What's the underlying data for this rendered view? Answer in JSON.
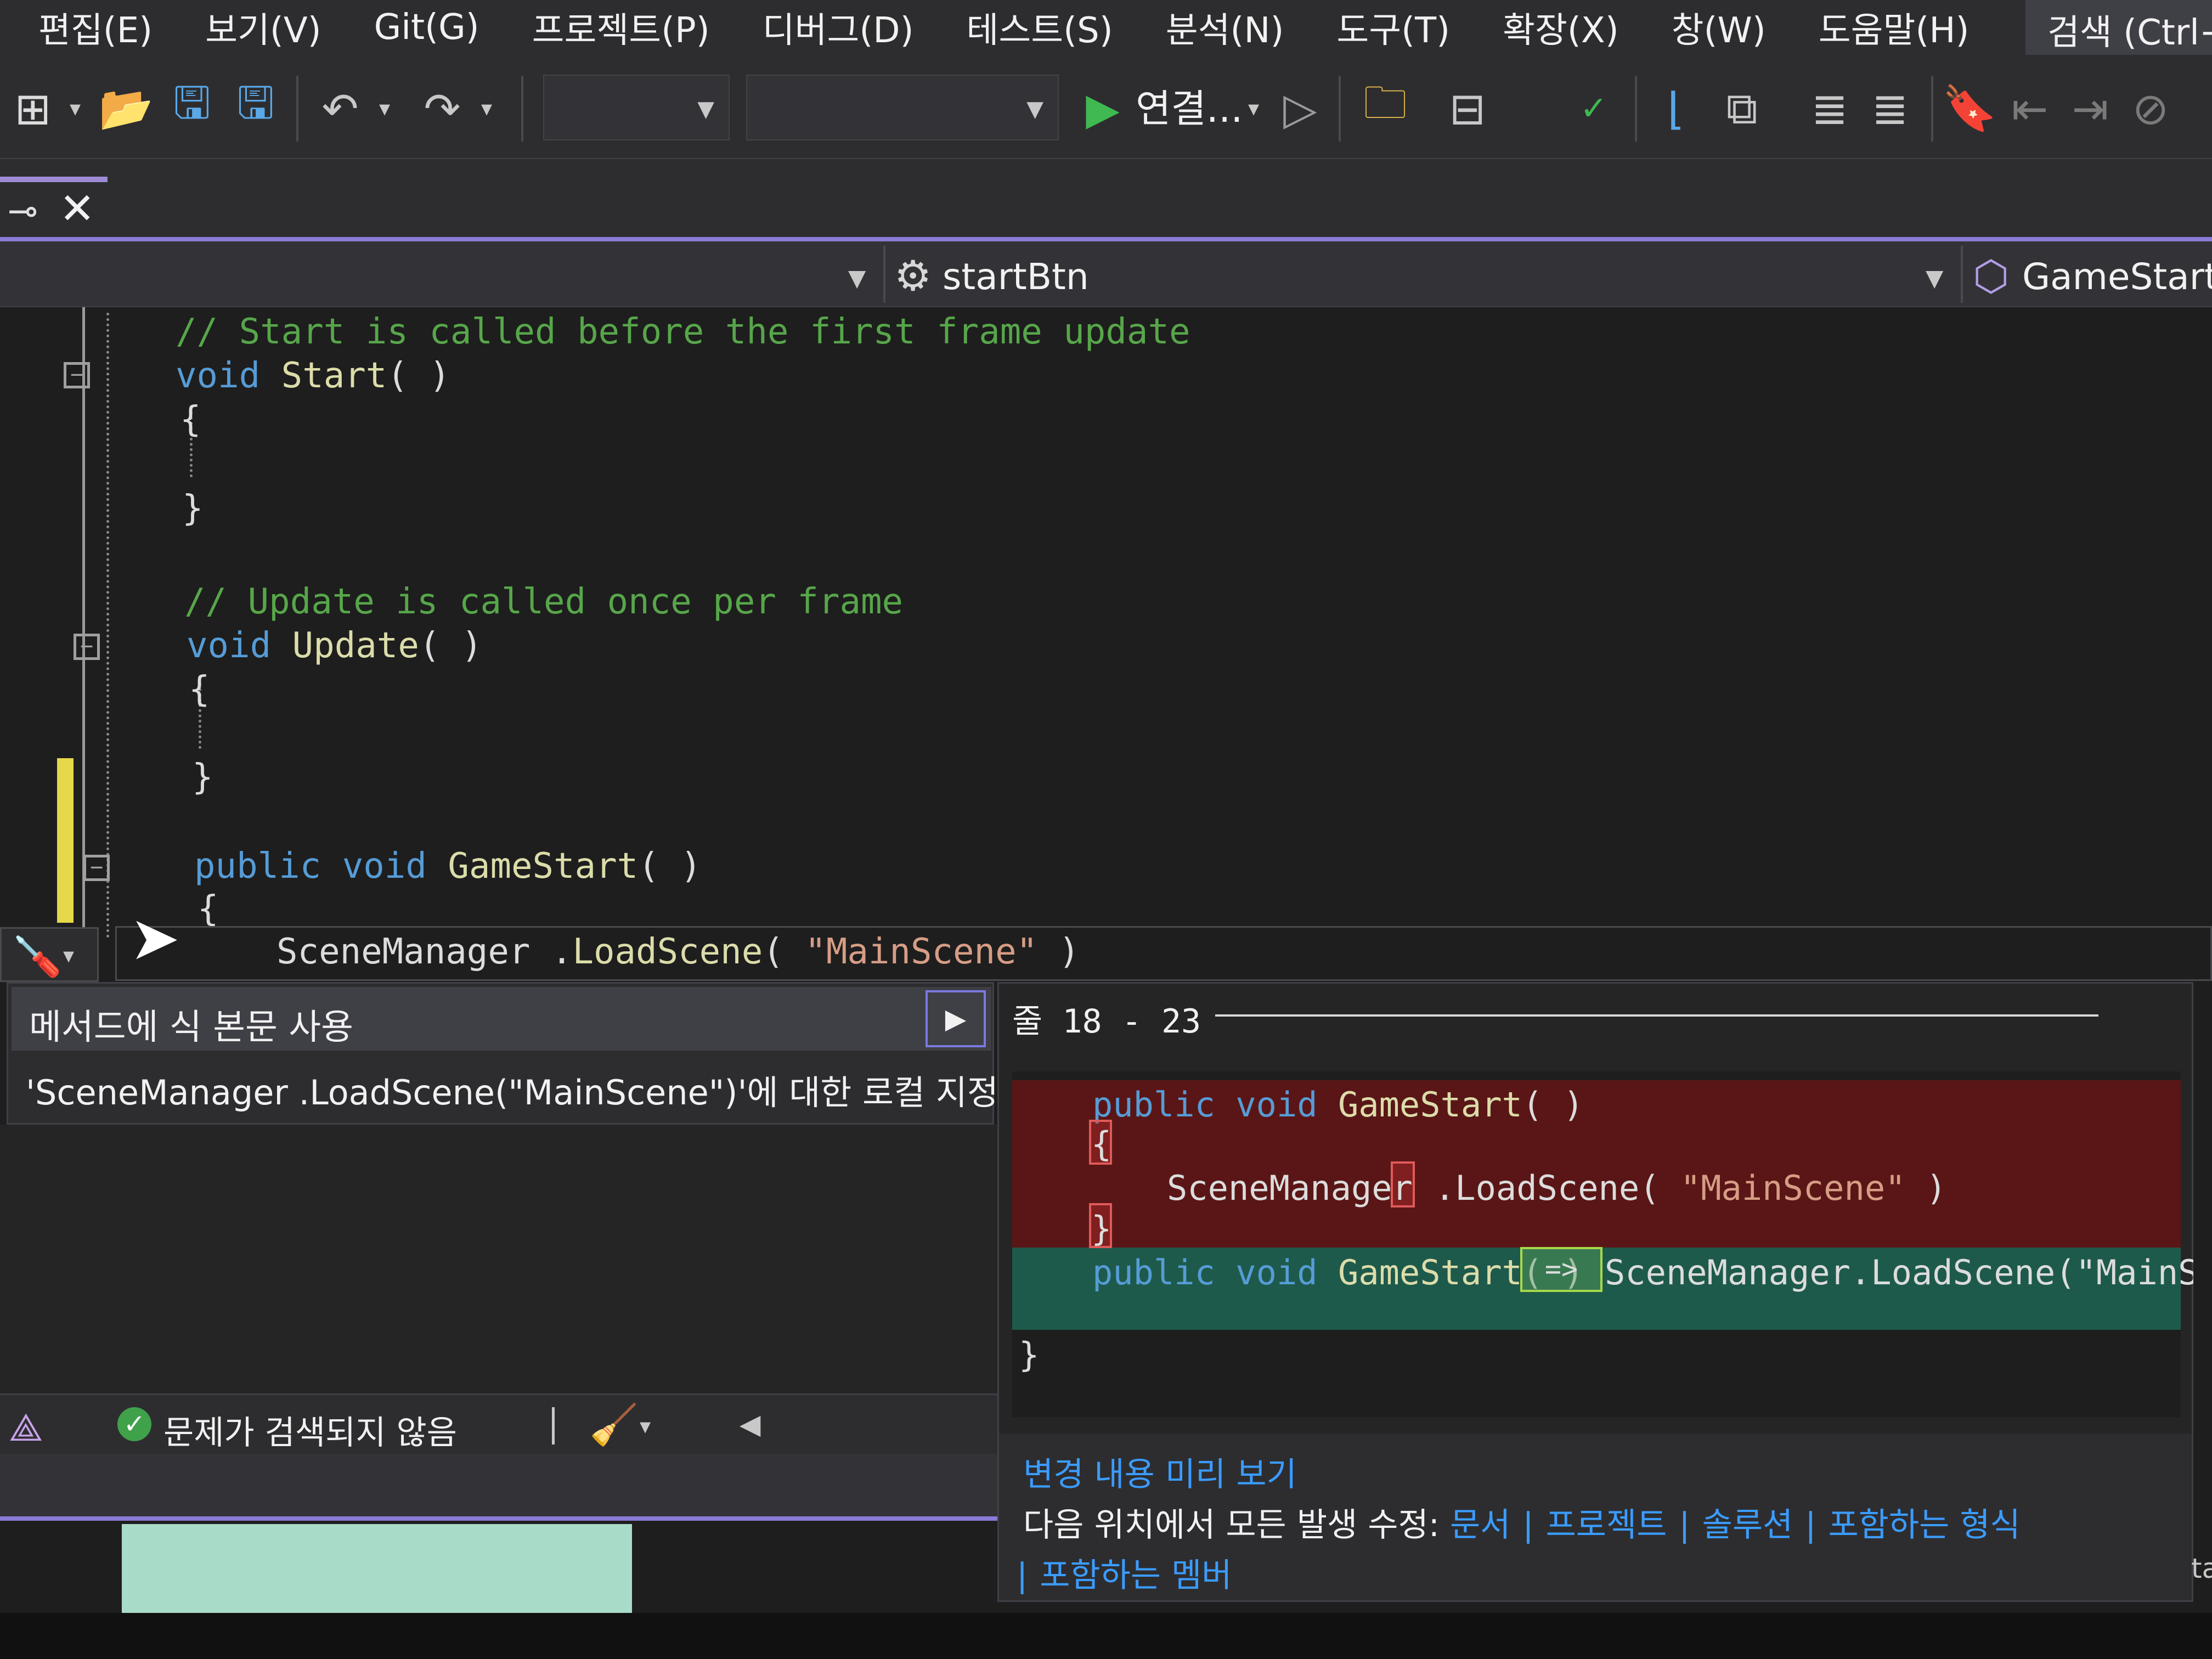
{
  "menu": {
    "items": [
      "편집(E)",
      "보기(V)",
      "Git(G)",
      "프로젝트(P)",
      "디버그(D)",
      "테스트(S)",
      "분석(N)",
      "도구(T)",
      "확장(X)",
      "창(W)",
      "도움말(H)"
    ],
    "search": "검색 (Ctrl+"
  },
  "toolbar": {
    "run_label": "연결...",
    "icons": [
      "new-project-icon",
      "open-folder-icon",
      "save-icon",
      "save-all-icon",
      "undo-icon",
      "redo-icon",
      "start-icon",
      "start-without-debug-icon",
      "solution-explorer-icon",
      "spell-check-icon",
      "bookmark-icon"
    ]
  },
  "navbar": {
    "member": "startBtn",
    "method": "GameStart()"
  },
  "editor": {
    "line1_comment": "// Start is called before the first frame update",
    "line2_kw": "void",
    "line2_fn": "Start",
    "line2_rest": "( )",
    "line3": "{",
    "line4": "}",
    "line5_comment": "// Update is called once per frame",
    "line6_kw": "void",
    "line6_fn": "Update",
    "line6_rest": "( )",
    "line7": "{",
    "line8": "}",
    "line9_kw": "public void",
    "line9_fn": "GameStart",
    "line9_rest": "( )",
    "line10": "{",
    "line11_pre": "SceneManager .",
    "line11_fn": "LoadScene",
    "line11_open": "( ",
    "line11_str": "\"MainScene\"",
    "line11_close": " )"
  },
  "quick_actions": {
    "item1": "메서드에 식 본문 사용",
    "item2": "'SceneManager .LoadScene(\"MainScene\")'에 대한 로컬 지정"
  },
  "preview": {
    "line_label": "줄 18 - 23",
    "del_line1_kw": "public void",
    "del_line1_fn": "GameStart",
    "del_line1_rest": "( )",
    "del_line2": "{",
    "del_line3_pre": "SceneManager",
    "del_line3_fn": ".LoadScene",
    "del_line3_open": "( ",
    "del_line3_str": "\"MainScene\"",
    "del_line3_close": " )",
    "del_line4": "}",
    "add_line_kw": "public void",
    "add_line_fn": "GameStart",
    "add_line_rest": "( )",
    "add_arrow": "=>",
    "add_line_tail": "SceneManager.LoadScene(\"MainScer",
    "close_brace": "}",
    "preview_changes": "변경 내용 미리 보기",
    "fix_all_prefix": "다음 위치에서 모든 발생 수정: ",
    "scope_document": "문서",
    "scope_project": "프로젝트",
    "scope_solution": "솔루션",
    "scope_containing_type": "포함하는 형식",
    "scope_containing_member": "포함하는 멤버"
  },
  "status": {
    "issues": "문제가 검색되지 않음"
  },
  "edge_text": "ta",
  "colors": {
    "comment": "#57a64a",
    "keyword": "#569cd6",
    "function": "#dcdcaa",
    "string": "#d69d85",
    "link": "#3b9cff",
    "accent": "#8b7ad6",
    "diff_removed": "#5a1616",
    "diff_added": "#1e5a4b"
  }
}
